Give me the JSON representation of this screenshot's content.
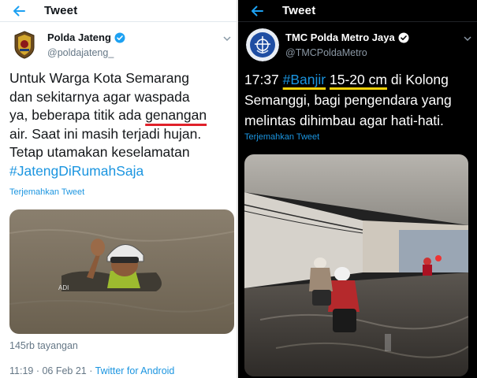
{
  "left": {
    "topbar": {
      "title": "Tweet"
    },
    "author": {
      "name": "Polda Jateng",
      "handle": "@poldajateng_"
    },
    "text_lines": [
      {
        "a": "Untuk Warga Kota Semarang",
        "u": "",
        "b": ""
      },
      {
        "a": "dan sekitarnya agar waspada",
        "u": "",
        "b": ""
      },
      {
        "a": "ya, beberapa titik ada ",
        "u": "genangan",
        "b": ""
      },
      {
        "a": "air. Saat ini masih terjadi hujan.",
        "u": "",
        "b": ""
      },
      {
        "a": "Tetap utamakan keselamatan",
        "u": "",
        "b": ""
      }
    ],
    "hashtag": "#JatengDiRumahSaja",
    "translate": "Terjemahkan Tweet",
    "views": "145rb tayangan",
    "meta": {
      "time_date": "11:19 · 06 Feb 21 · ",
      "client": "Twitter for Android"
    }
  },
  "right": {
    "topbar": {
      "title": "Tweet"
    },
    "author": {
      "name": "TMC Polda Metro Jaya",
      "handle": "@TMCPoldaMetro"
    },
    "text_line1": {
      "time": "17:37 ",
      "hashtag": "#Banjir",
      "sp": " ",
      "depth": "15-20 cm",
      "rest": " di Kolong"
    },
    "text_line2": "Semanggi, bagi pengendara yang",
    "text_line3": "melintas dihimbau agar hati-hati.",
    "translate": "Terjemahkan Tweet"
  },
  "colors": {
    "link_blue": "#1b95e0",
    "verified_blue": "#1da1f2",
    "underline_red": "#e0212b",
    "underline_yellow": "#f5d20a"
  },
  "icons": [
    "back-arrow-icon",
    "verified-badge-icon",
    "chevron-down-icon"
  ]
}
